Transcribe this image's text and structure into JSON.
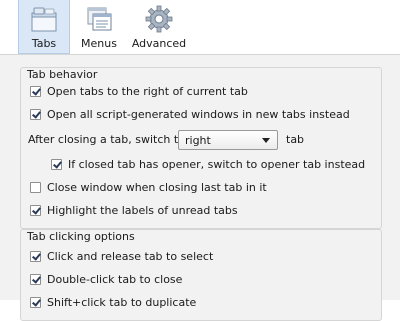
{
  "toolbar": {
    "tabs_label": "Tabs",
    "menus_label": "Menus",
    "advanced_label": "Advanced"
  },
  "tab_behavior": {
    "title": "Tab behavior",
    "open_right": {
      "label": "Open tabs to the right of current tab",
      "checked": true
    },
    "open_script": {
      "label": "Open all script-generated windows in new tabs instead",
      "checked": true
    },
    "after_close_prefix": "After closing a tab, switch to",
    "after_close_value": "right",
    "after_close_suffix": "tab",
    "opener": {
      "label": "If closed tab has opener, switch to opener tab instead",
      "checked": true
    },
    "close_window": {
      "label": "Close window when closing last tab in it",
      "checked": false
    },
    "highlight_unread": {
      "label": "Highlight the labels of unread tabs",
      "checked": true
    }
  },
  "tab_clicking": {
    "title": "Tab clicking options",
    "click_release": {
      "label": "Click and release tab to select",
      "checked": true
    },
    "double_click": {
      "label": "Double-click tab to close",
      "checked": true
    },
    "shift_click": {
      "label": "Shift+click tab to duplicate",
      "checked": true
    }
  }
}
